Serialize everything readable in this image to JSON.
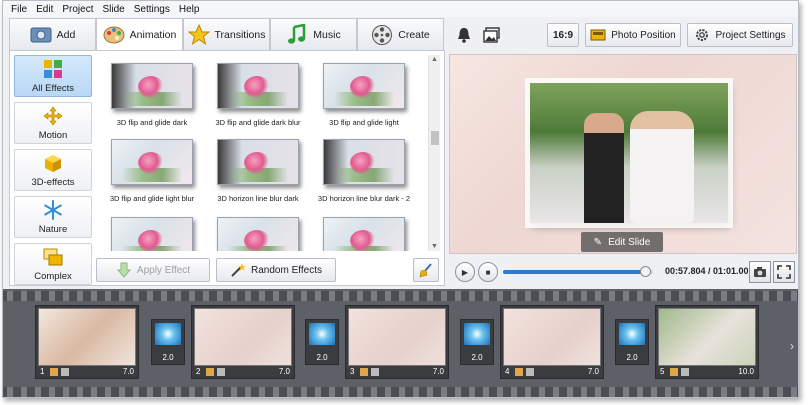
{
  "menu": [
    "File",
    "Edit",
    "Project",
    "Slide",
    "Settings",
    "Help"
  ],
  "tabs": [
    {
      "label": "Add",
      "icon": "add-photos-icon",
      "active": false
    },
    {
      "label": "Animation",
      "icon": "palette-icon",
      "active": true
    },
    {
      "label": "Transitions",
      "icon": "star-icon",
      "active": false
    },
    {
      "label": "Music",
      "icon": "music-note-icon",
      "active": false
    },
    {
      "label": "Create",
      "icon": "film-reel-icon",
      "active": false
    }
  ],
  "categories": [
    {
      "label": "All Effects",
      "icon": "all-effects-icon",
      "active": true
    },
    {
      "label": "Motion",
      "icon": "motion-icon",
      "active": false
    },
    {
      "label": "3D-effects",
      "icon": "cube-icon",
      "active": false
    },
    {
      "label": "Nature",
      "icon": "snowflake-icon",
      "active": false
    },
    {
      "label": "Complex",
      "icon": "complex-icon",
      "active": false
    }
  ],
  "effects": [
    {
      "label": "3D flip and glide dark"
    },
    {
      "label": "3D flip and glide dark blur"
    },
    {
      "label": "3D flip and glide light"
    },
    {
      "label": "3D flip and glide light blur"
    },
    {
      "label": "3D horizon line blur dark"
    },
    {
      "label": "3D horizon line blur dark - 2"
    },
    {
      "label": ""
    },
    {
      "label": ""
    },
    {
      "label": ""
    }
  ],
  "buttons": {
    "apply_effect": "Apply Effect",
    "random_effects": "Random Effects",
    "aspect": "16:9",
    "photo_position": "Photo Position",
    "project_settings": "Project Settings",
    "edit_slide": "Edit Slide"
  },
  "player": {
    "time": "00:57.804 / 01:01.000",
    "progress": 0.948
  },
  "timeline": {
    "slides": [
      {
        "num": "1",
        "duration": "7.0"
      },
      {
        "num": "2",
        "duration": "7.0"
      },
      {
        "num": "3",
        "duration": "7.0"
      },
      {
        "num": "4",
        "duration": "7.0"
      },
      {
        "num": "5",
        "duration": "10.0"
      }
    ],
    "transitions": [
      "2.0",
      "2.0",
      "2.0",
      "2.0"
    ]
  }
}
